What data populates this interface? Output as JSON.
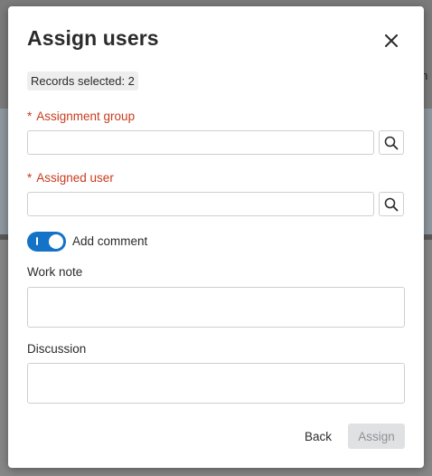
{
  "background": {
    "peek_text": "n"
  },
  "modal": {
    "title": "Assign users",
    "close_icon": "close-icon",
    "records_selected": "Records selected: 2",
    "assignment_group": {
      "required_mark": "*",
      "label": "Assignment group",
      "value": "",
      "search_icon": "search-icon"
    },
    "assigned_user": {
      "required_mark": "*",
      "label": "Assigned user",
      "value": "",
      "search_icon": "search-icon"
    },
    "add_comment": {
      "label": "Add comment",
      "enabled": true
    },
    "work_note": {
      "label": "Work note",
      "value": ""
    },
    "discussion": {
      "label": "Discussion",
      "value": ""
    },
    "footer": {
      "back_label": "Back",
      "assign_label": "Assign",
      "assign_disabled": true
    }
  },
  "colors": {
    "required": "#c83c1e",
    "toggle_on": "#1473c6",
    "disabled_button_bg": "#dfe1e3",
    "disabled_button_text": "#8e9398"
  }
}
